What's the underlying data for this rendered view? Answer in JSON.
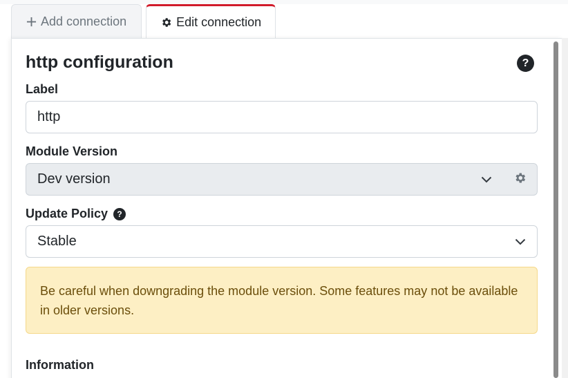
{
  "tabs": [
    {
      "label": "Add connection",
      "icon": "plus-icon",
      "active": false
    },
    {
      "label": "Edit connection",
      "icon": "gear-icon",
      "active": true
    }
  ],
  "form": {
    "title": "http configuration",
    "label_field": {
      "label": "Label",
      "value": "http"
    },
    "module_version": {
      "label": "Module Version",
      "value": "Dev version"
    },
    "update_policy": {
      "label": "Update Policy",
      "value": "Stable"
    },
    "alert": "Be careful when downgrading the module version. Some features may not be available in older versions.",
    "section": "Information"
  },
  "colors": {
    "active_tab_accent": "#d11b2a",
    "alert_bg": "#fdefc4",
    "alert_text": "#6b4e0b"
  }
}
